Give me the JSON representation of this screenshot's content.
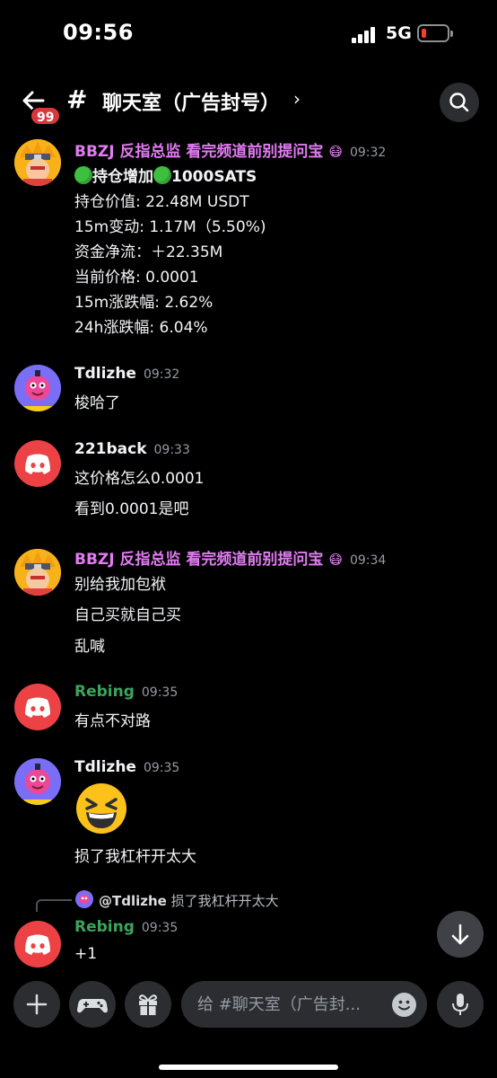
{
  "status_bar": {
    "time": "09:56",
    "network": "5G"
  },
  "header": {
    "badge": "99",
    "channel_name": "聊天室（广告封号）"
  },
  "messages": [
    {
      "username": "BBZJ 反指总监  看完频道前别提问宝",
      "timestamp": "09:32",
      "lines": [
        "持仓增加",
        "1000SATS",
        "持仓价值: 22.48M USDT",
        "15m变动: 1.17M（5.50%)",
        "资金净流：＋22.35M",
        "当前价格: 0.0001",
        "15m涨跌幅: 2.62%",
        "24h涨跌幅: 6.04%"
      ]
    },
    {
      "username": "Tdlizhe",
      "timestamp": "09:32",
      "lines": [
        "梭哈了"
      ]
    },
    {
      "username": "221back",
      "timestamp": "09:33",
      "lines": [
        "这价格怎么0.0001",
        "看到0.0001是吧"
      ]
    },
    {
      "username": "BBZJ 反指总监  看完频道前别提问宝",
      "timestamp": "09:34",
      "lines": [
        "别给我加包袱",
        "自己买就自己买",
        "乱喊"
      ]
    },
    {
      "username": "Rebing",
      "timestamp": "09:35",
      "lines": [
        "有点不对路"
      ]
    },
    {
      "username": "Tdlizhe",
      "timestamp": "09:35",
      "lines": [
        "损了我杠杆开太大"
      ]
    },
    {
      "username": "Rebing",
      "timestamp": "09:35",
      "lines": [
        "+1"
      ]
    }
  ],
  "reply": {
    "mention": "@Tdlizhe",
    "text": "损了我杠杆开太大"
  },
  "composer": {
    "placeholder": "给 #聊天室（广告封..."
  },
  "colors": {
    "username_magenta": "#e27bf2",
    "username_green": "#3ba55c",
    "discord_red": "#ed4245",
    "surface": "#2b2d31"
  }
}
